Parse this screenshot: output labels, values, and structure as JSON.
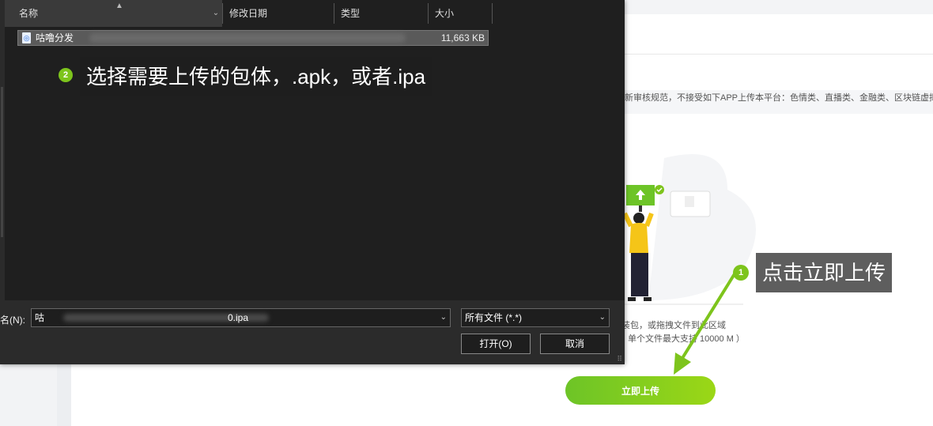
{
  "file_dialog": {
    "columns": [
      {
        "label": "名称"
      },
      {
        "label": "修改日期"
      },
      {
        "label": "类型"
      },
      {
        "label": "大小"
      }
    ],
    "file_row": {
      "name": "咕噜分发",
      "size": "11,663 KB"
    },
    "file_name_label": "名(N):",
    "file_name_value_start": "咕",
    "file_name_value_end": "0.ipa",
    "file_type_filter": "所有文件 (*.*)",
    "open_button": "打开(O)",
    "cancel_button": "取消"
  },
  "callouts": {
    "step2": {
      "number": "2",
      "text": "选择需要上传的包体，.apk，或者.ipa"
    },
    "step1": {
      "number": "1",
      "text": "点击立即上传"
    }
  },
  "page": {
    "notice": "新审核规范，不接受如下APP上传本平台：色情类、直播类、金融类、区块链虚拟币",
    "upload_hint_line1": "装包，或拖拽文件到此区域",
    "upload_hint_line2": "单个文件最大支持 10000 M ）",
    "upload_button": "立即上传"
  },
  "colors": {
    "accent_green": "#7dc41c",
    "illustration_yellow": "#f5c518"
  }
}
